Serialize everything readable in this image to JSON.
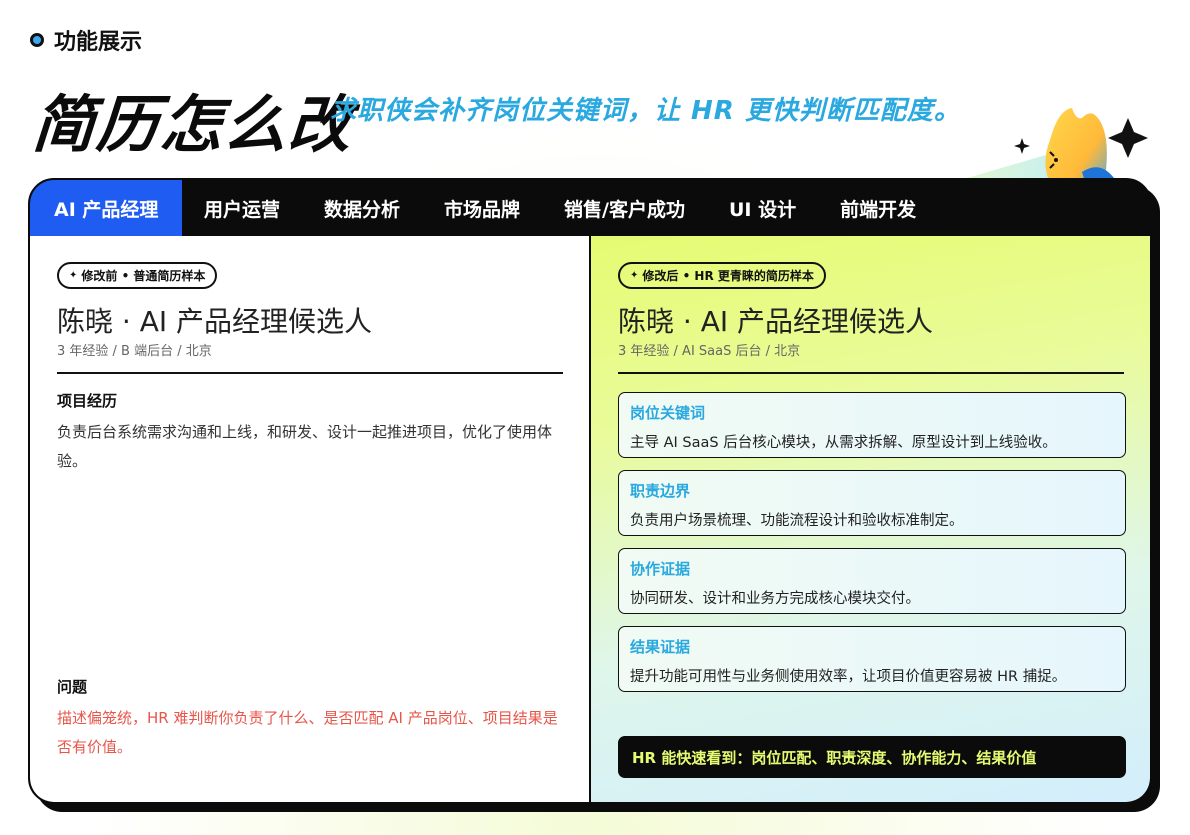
{
  "header": {
    "section_label": "功能展示",
    "title": "简历怎么改",
    "subtitle": "求职侠会补齐岗位关键词，让 HR 更快判断匹配度。"
  },
  "tabs": [
    {
      "label": "AI 产品经理",
      "active": true
    },
    {
      "label": "用户运营",
      "active": false
    },
    {
      "label": "数据分析",
      "active": false
    },
    {
      "label": "市场品牌",
      "active": false
    },
    {
      "label": "销售/客户成功",
      "active": false
    },
    {
      "label": "UI 设计",
      "active": false
    },
    {
      "label": "前端开发",
      "active": false
    }
  ],
  "before": {
    "badge": "修改前 • 普通简历样本",
    "name": "陈晓 · AI 产品经理候选人",
    "meta": "3 年经验 / B 端后台 / 北京",
    "project_title": "项目经历",
    "project_text": "负责后台系统需求沟通和上线，和研发、设计一起推进项目，优化了使用体验。",
    "problem_title": "问题",
    "problem_text": "描述偏笼统，HR 难判断你负责了什么、是否匹配 AI 产品岗位、项目结果是否有价值。"
  },
  "after": {
    "badge": "修改后 • HR 更青睐的简历样本",
    "name": "陈晓 · AI 产品经理候选人",
    "meta": "3 年经验 / AI SaaS 后台 / 北京",
    "items": [
      {
        "title": "岗位关键词",
        "text": "主导 AI SaaS 后台核心模块，从需求拆解、原型设计到上线验收。"
      },
      {
        "title": "职责边界",
        "text": "负责用户场景梳理、功能流程设计和验收标准制定。"
      },
      {
        "title": "协作证据",
        "text": "协同研发、设计和业务方完成核心模块交付。"
      },
      {
        "title": "结果证据",
        "text": "提升功能可用性与业务侧使用效率，让项目价值更容易被 HR 捕捉。"
      }
    ],
    "summary": "HR 能快速看到：岗位匹配、职责深度、协作能力、结果价值"
  },
  "colors": {
    "accent_blue": "#1f5cf2",
    "keyword_cyan": "#2aa8e0",
    "warn_red": "#e8564a",
    "lime": "#e6fb72"
  }
}
